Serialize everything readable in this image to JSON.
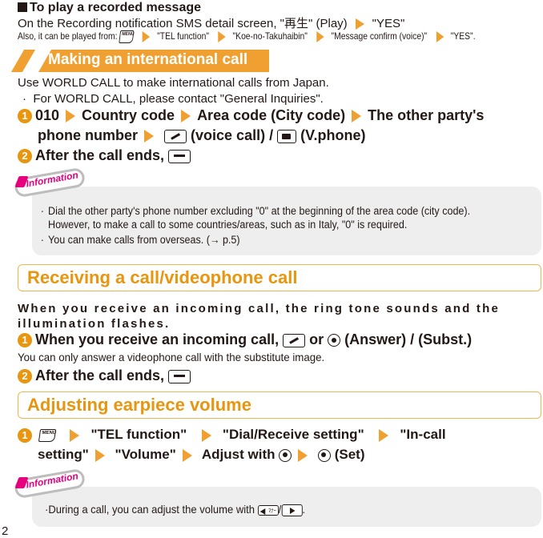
{
  "recorded": {
    "heading": "To play a recorded message",
    "line1": "On the Recording notification SMS detail screen, \"再生\" (Play)",
    "line1_end": "\"YES\"",
    "also_prefix": "Also, it can be played from:",
    "menu_key": "MENU",
    "also_steps": [
      "\"TEL function\"",
      "\"Koe-no-Takuhaibin\"",
      "\"Message confirm (voice)\"",
      "\"YES\"."
    ]
  },
  "international": {
    "title": "Making an international call",
    "intro": "Use WORLD CALL to make international calls from Japan.",
    "note": "For WORLD CALL, please contact \"General Inquiries\".",
    "step1": {
      "number": "1",
      "parts": [
        "010",
        "Country code",
        "Area code (City code)",
        "The other party's"
      ],
      "line2_a": "phone number",
      "line2_b": "(voice call) /",
      "line2_c": "(V.phone)"
    },
    "step2": {
      "number": "2",
      "text": "After the call ends,"
    },
    "info": {
      "tag": "Information",
      "bullets": [
        "Dial the other party's phone number excluding \"0\" at the beginning of the area code (city code). However, to make a call to some countries/areas, such as in Italy, \"0\" is  required.",
        "You can make calls from overseas. (→ p.5)"
      ]
    }
  },
  "receiving": {
    "title": "Receiving a call/videophone call",
    "intro": "When you receive an incoming call, the ring tone sounds and the illumination flashes.",
    "step1": {
      "number": "1",
      "text_a": "When you receive an incoming call,",
      "text_b": "or",
      "text_c": "(Answer) / (Subst.)"
    },
    "note": "You can only answer a videophone call with the substitute image.",
    "step2": {
      "number": "2",
      "text": "After the call ends,"
    }
  },
  "volume": {
    "title": "Adjusting earpiece volume",
    "step1": {
      "number": "1",
      "menu_key": "MENU",
      "parts": [
        "\"TEL function\"",
        "\"Dial/Receive setting\"",
        "\"In-call"
      ],
      "line2": [
        "setting\"",
        "\"Volume\"",
        "Adjust with"
      ],
      "set": "(Set)"
    },
    "info": {
      "tag": "Information",
      "bullet_a": "During a call, you can adjust the volume with",
      "key_label": "ﾏﾅｰ",
      "bullet_end": "."
    }
  },
  "page_number": "2",
  "colors": {
    "accent": "#e8950f",
    "arrow": "#f0a030",
    "info_pink": "#e6007e",
    "info_bg": "#eeeeee"
  }
}
